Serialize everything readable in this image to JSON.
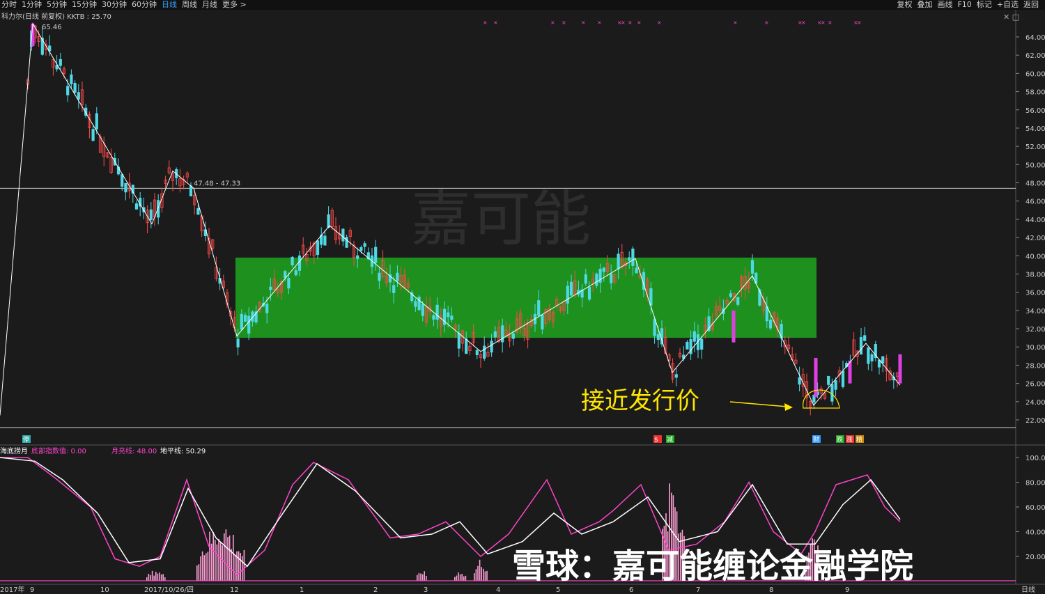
{
  "toolbar": {
    "periods": [
      "分时",
      "1分钟",
      "5分钟",
      "15分钟",
      "30分钟",
      "60分钟",
      "日线",
      "周线",
      "月线",
      "更多 >"
    ],
    "active_period": "日线",
    "right_buttons": [
      "复权",
      "叠加",
      "画线",
      "F10",
      "标记",
      "+自选",
      "返回"
    ]
  },
  "main_panel": {
    "title": "科力尔(日线 前复权) KKTB : 25.70",
    "peak_label": "65.46",
    "resistance_label": "47.48 - 47.33",
    "watermark": "嘉可能",
    "annotation": "接近发行价",
    "badges": [
      "停",
      "$",
      "减",
      "财",
      "跌",
      "涨",
      "精"
    ]
  },
  "sub_panel": {
    "title": "海底捞月",
    "legend": [
      {
        "label": "底部指数值: 0.00",
        "color": "#ff44cc"
      },
      {
        "label": "月亮线: 48.00",
        "color": "#ff44cc"
      },
      {
        "label": "地平线: 50.29",
        "color": "#ffffff"
      }
    ],
    "y_ticks": [
      "100.0",
      "80.00",
      "60.00",
      "40.00",
      "20.00"
    ]
  },
  "x_axis_labels": [
    "2017年",
    "9",
    "10",
    "2017/10/26/四",
    "12",
    "1",
    "2",
    "3",
    "4",
    "5",
    "6",
    "7",
    "8",
    "9"
  ],
  "corner_label": "日线",
  "footer_watermark": "雪球：嘉可能缠论金融学院",
  "colors": {
    "up": "#ff4a4a",
    "down": "#4fd9e6",
    "highlight_box": "#22c322",
    "zigzag": "#ffffff",
    "annotation": "#ffe600",
    "osc_pink": "#ff44cc"
  },
  "chart_data": {
    "type": "candlestick",
    "y_ticks_main": [
      "64.00",
      "62.00",
      "60.00",
      "58.00",
      "56.00",
      "54.00",
      "52.00",
      "50.00",
      "48.00",
      "46.00",
      "44.00",
      "42.00",
      "40.00",
      "38.00",
      "36.00",
      "34.00",
      "32.00",
      "30.00",
      "28.00",
      "26.00",
      "24.00",
      "22.00"
    ],
    "ylim": [
      21,
      66
    ],
    "resistance_level": 47.4,
    "green_zone": {
      "y_low": 31.0,
      "y_high": 39.8
    },
    "zigzag": [
      [
        0,
        22.5
      ],
      [
        47,
        65.46
      ],
      [
        218,
        43.5
      ],
      [
        248,
        49.3
      ],
      [
        278,
        47.4
      ],
      [
        340,
        31.2
      ],
      [
        473,
        43.3
      ],
      [
        690,
        29.5
      ],
      [
        912,
        39.7
      ],
      [
        965,
        27.2
      ],
      [
        1080,
        37.8
      ],
      [
        1168,
        23.6
      ],
      [
        1243,
        30.4
      ],
      [
        1292,
        25.8
      ]
    ],
    "sub_ylim": [
      0,
      100
    ]
  }
}
